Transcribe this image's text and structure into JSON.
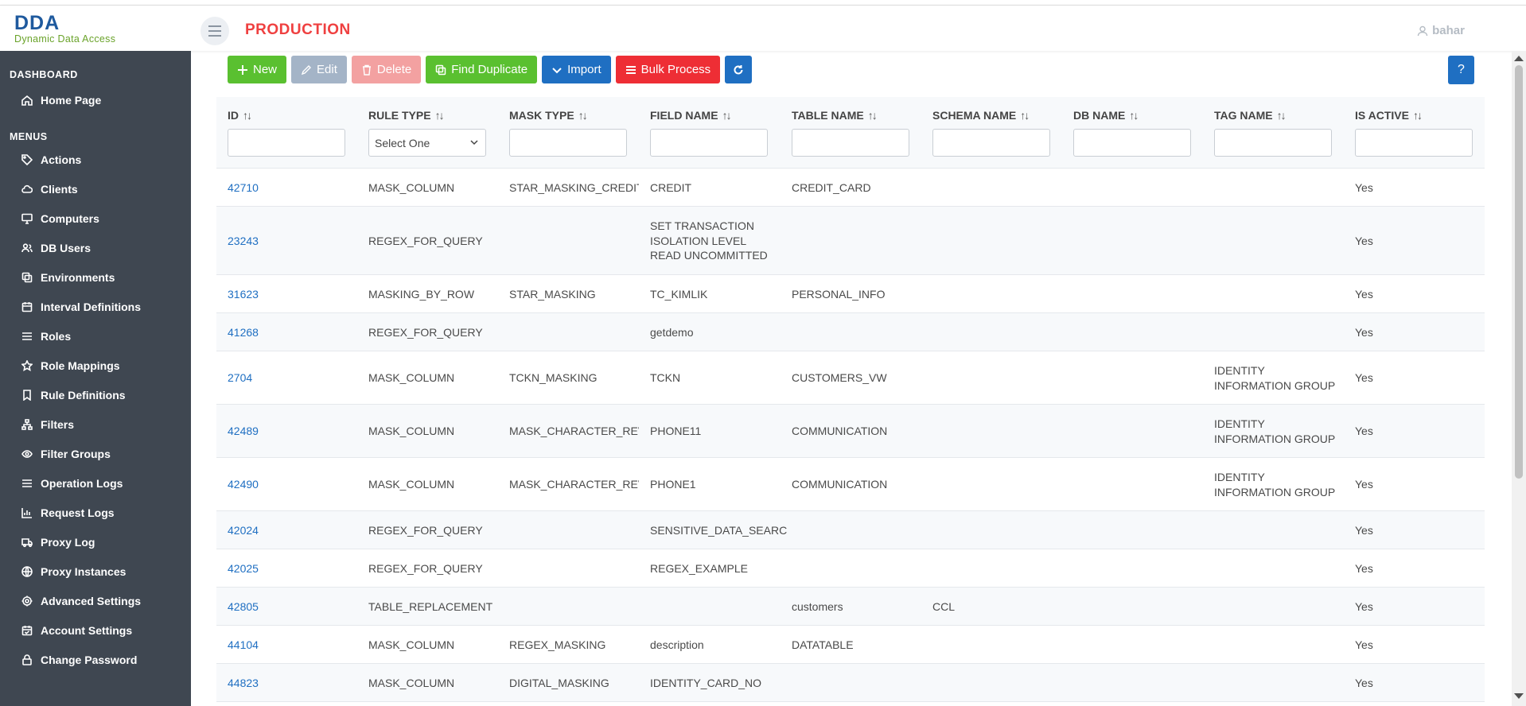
{
  "header": {
    "logo_mark": "DDA",
    "logo_sub": "Dynamic Data Access",
    "page_title": "PRODUCTION",
    "user_name": "bahar"
  },
  "sidebar": {
    "sections": [
      {
        "title": "DASHBOARD",
        "items": [
          {
            "label": "Home Page",
            "icon": "home-icon"
          }
        ]
      },
      {
        "title": "MENUS",
        "items": [
          {
            "label": "Actions",
            "icon": "tag-icon"
          },
          {
            "label": "Clients",
            "icon": "cloud-icon"
          },
          {
            "label": "Computers",
            "icon": "monitor-icon"
          },
          {
            "label": "DB Users",
            "icon": "users-icon"
          },
          {
            "label": "Environments",
            "icon": "copy-icon"
          },
          {
            "label": "Interval Definitions",
            "icon": "calendar-icon"
          },
          {
            "label": "Roles",
            "icon": "list-icon"
          },
          {
            "label": "Role Mappings",
            "icon": "star-icon"
          },
          {
            "label": "Rule Definitions",
            "icon": "bookmark-icon"
          },
          {
            "label": "Filters",
            "icon": "sitemap-icon"
          },
          {
            "label": "Filter Groups",
            "icon": "eye-icon"
          },
          {
            "label": "Operation Logs",
            "icon": "list-icon"
          },
          {
            "label": "Request Logs",
            "icon": "chart-icon"
          },
          {
            "label": "Proxy Log",
            "icon": "truck-icon"
          },
          {
            "label": "Proxy Instances",
            "icon": "globe-icon"
          },
          {
            "label": "Advanced Settings",
            "icon": "gear-icon"
          },
          {
            "label": "Account Settings",
            "icon": "calendar-check-icon"
          },
          {
            "label": "Change Password",
            "icon": "lock-icon"
          }
        ]
      }
    ]
  },
  "toolbar": {
    "new_label": "New",
    "edit_label": "Edit",
    "delete_label": "Delete",
    "find_duplicate_label": "Find Duplicate",
    "import_label": "Import",
    "bulk_process_label": "Bulk Process",
    "help_label": "?"
  },
  "table": {
    "columns": [
      "ID",
      "RULE TYPE",
      "MASK TYPE",
      "FIELD NAME",
      "TABLE NAME",
      "SCHEMA NAME",
      "DB NAME",
      "TAG NAME",
      "IS ACTIVE"
    ],
    "rule_type_placeholder": "Select One",
    "rows": [
      {
        "id": "42710",
        "rule_type": "MASK_COLUMN",
        "mask_type": "STAR_MASKING_CREDIT_CARD",
        "field_name": [
          "CREDIT"
        ],
        "table_name": "CREDIT_CARD",
        "schema_name": "",
        "db_name": "",
        "tag_name": [],
        "is_active": "Yes"
      },
      {
        "id": "23243",
        "rule_type": "REGEX_FOR_QUERY",
        "mask_type": "",
        "field_name": [
          "SET TRANSACTION",
          "ISOLATION LEVEL",
          "READ UNCOMMITTED"
        ],
        "table_name": "",
        "schema_name": "",
        "db_name": "",
        "tag_name": [],
        "is_active": "Yes"
      },
      {
        "id": "31623",
        "rule_type": "MASKING_BY_ROW",
        "mask_type": "STAR_MASKING",
        "field_name": [
          "TC_KIMLIK"
        ],
        "table_name": "PERSONAL_INFO",
        "schema_name": "",
        "db_name": "",
        "tag_name": [],
        "is_active": "Yes"
      },
      {
        "id": "41268",
        "rule_type": "REGEX_FOR_QUERY",
        "mask_type": "",
        "field_name": [
          "getdemo"
        ],
        "table_name": "",
        "schema_name": "",
        "db_name": "",
        "tag_name": [],
        "is_active": "Yes"
      },
      {
        "id": "2704",
        "rule_type": "MASK_COLUMN",
        "mask_type": "TCKN_MASKING",
        "field_name": [
          "TCKN"
        ],
        "table_name": "CUSTOMERS_VW",
        "schema_name": "",
        "db_name": "",
        "tag_name": [
          "IDENTITY",
          "INFORMATION GROUP"
        ],
        "is_active": "Yes"
      },
      {
        "id": "42489",
        "rule_type": "MASK_COLUMN",
        "mask_type": "MASK_CHARACTER_REVERSE",
        "field_name": [
          "PHONE11"
        ],
        "table_name": "COMMUNICATION",
        "schema_name": "",
        "db_name": "",
        "tag_name": [
          "IDENTITY",
          "INFORMATION GROUP"
        ],
        "is_active": "Yes"
      },
      {
        "id": "42490",
        "rule_type": "MASK_COLUMN",
        "mask_type": "MASK_CHARACTER_REVERSE",
        "field_name": [
          "PHONE1"
        ],
        "table_name": "COMMUNICATION",
        "schema_name": "",
        "db_name": "",
        "tag_name": [
          "IDENTITY",
          "INFORMATION GROUP"
        ],
        "is_active": "Yes"
      },
      {
        "id": "42024",
        "rule_type": "REGEX_FOR_QUERY",
        "mask_type": "",
        "field_name": [
          "SENSITIVE_DATA_SEARCH"
        ],
        "table_name": "",
        "schema_name": "",
        "db_name": "",
        "tag_name": [],
        "is_active": "Yes"
      },
      {
        "id": "42025",
        "rule_type": "REGEX_FOR_QUERY",
        "mask_type": "",
        "field_name": [
          "REGEX_EXAMPLE"
        ],
        "table_name": "",
        "schema_name": "",
        "db_name": "",
        "tag_name": [],
        "is_active": "Yes"
      },
      {
        "id": "42805",
        "rule_type": "TABLE_REPLACEMENT",
        "mask_type": "",
        "field_name": [],
        "table_name": "customers",
        "schema_name": "CCL",
        "db_name": "",
        "tag_name": [],
        "is_active": "Yes"
      },
      {
        "id": "44104",
        "rule_type": "MASK_COLUMN",
        "mask_type": "REGEX_MASKING",
        "field_name": [
          "description"
        ],
        "table_name": "DATATABLE",
        "schema_name": "",
        "db_name": "",
        "tag_name": [],
        "is_active": "Yes"
      },
      {
        "id": "44823",
        "rule_type": "MASK_COLUMN",
        "mask_type": "DIGITAL_MASKING",
        "field_name": [
          "IDENTITY_CARD_NO"
        ],
        "table_name": "",
        "schema_name": "",
        "db_name": "",
        "tag_name": [],
        "is_active": "Yes"
      }
    ]
  }
}
